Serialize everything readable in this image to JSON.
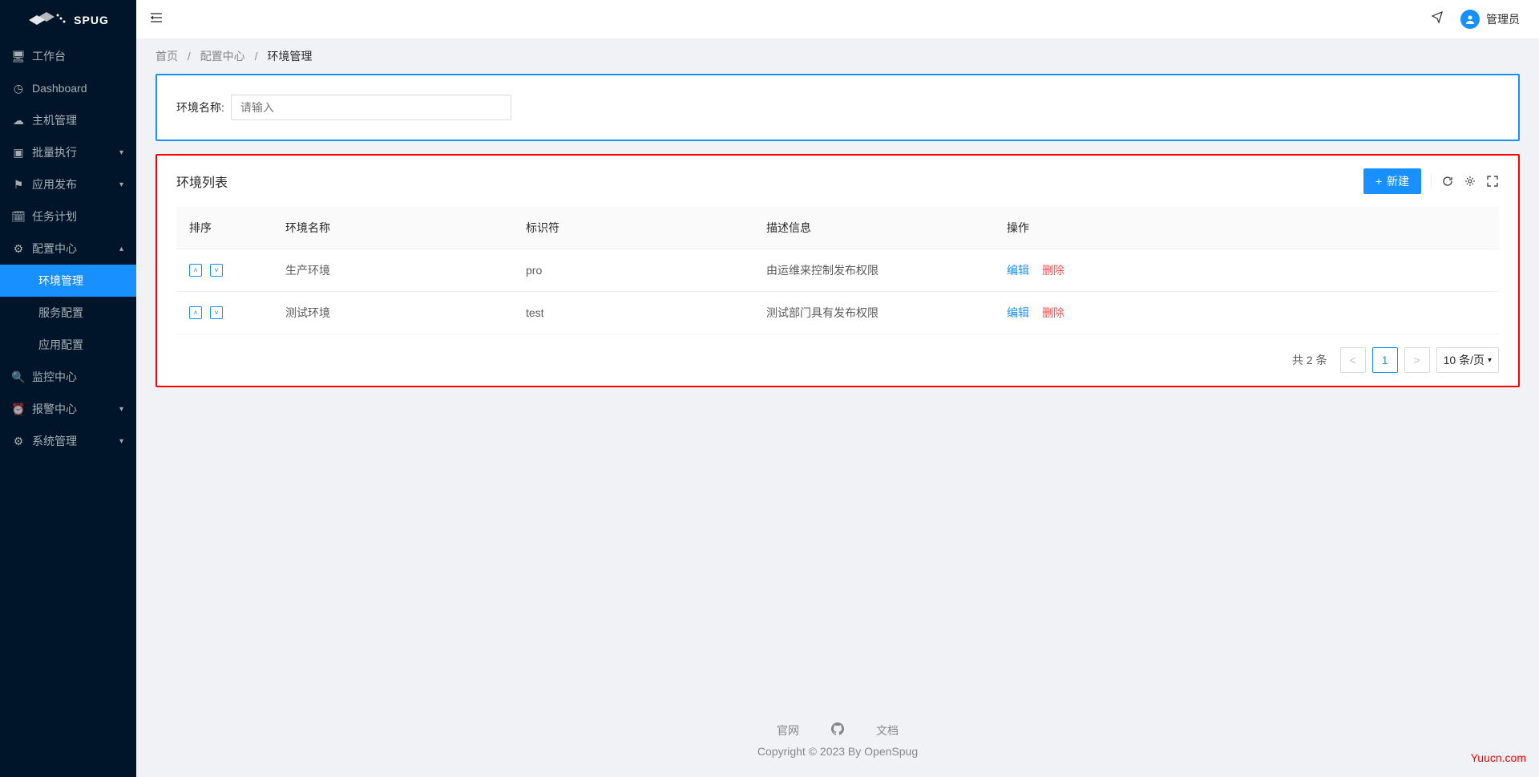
{
  "app_name": "SPUG",
  "header": {
    "user_name": "管理员"
  },
  "breadcrumb": {
    "home": "首页",
    "center": "配置中心",
    "current": "环境管理"
  },
  "sidebar": {
    "items": [
      {
        "label": "工作台",
        "icon": "desktop"
      },
      {
        "label": "Dashboard",
        "icon": "dashboard"
      },
      {
        "label": "主机管理",
        "icon": "cloud"
      },
      {
        "label": "批量执行",
        "icon": "code",
        "expandable": true
      },
      {
        "label": "应用发布",
        "icon": "flag",
        "expandable": true
      },
      {
        "label": "任务计划",
        "icon": "schedule"
      },
      {
        "label": "配置中心",
        "icon": "deploy",
        "expandable": true,
        "expanded": true
      },
      {
        "label": "环境管理",
        "sub": true,
        "active": true
      },
      {
        "label": "服务配置",
        "sub": true
      },
      {
        "label": "应用配置",
        "sub": true
      },
      {
        "label": "监控中心",
        "icon": "monitor"
      },
      {
        "label": "报警中心",
        "icon": "alert",
        "expandable": true
      },
      {
        "label": "系统管理",
        "icon": "setting",
        "expandable": true
      }
    ]
  },
  "search": {
    "label": "环境名称:",
    "placeholder": "请输入"
  },
  "list": {
    "title": "环境列表",
    "new_btn": "新建",
    "columns": [
      "排序",
      "环境名称",
      "标识符",
      "描述信息",
      "操作"
    ],
    "rows": [
      {
        "name": "生产环境",
        "identifier": "pro",
        "description": "由运维来控制发布权限"
      },
      {
        "name": "测试环境",
        "identifier": "test",
        "description": "测试部门具有发布权限"
      }
    ],
    "action_edit": "编辑",
    "action_delete": "删除"
  },
  "pagination": {
    "total_text": "共 2 条",
    "current_page": "1",
    "page_size": "10 条/页"
  },
  "footer": {
    "link_site": "官网",
    "link_docs": "文档",
    "copyright": "Copyright © 2023 By OpenSpug"
  },
  "watermark": "Yuucn.com"
}
